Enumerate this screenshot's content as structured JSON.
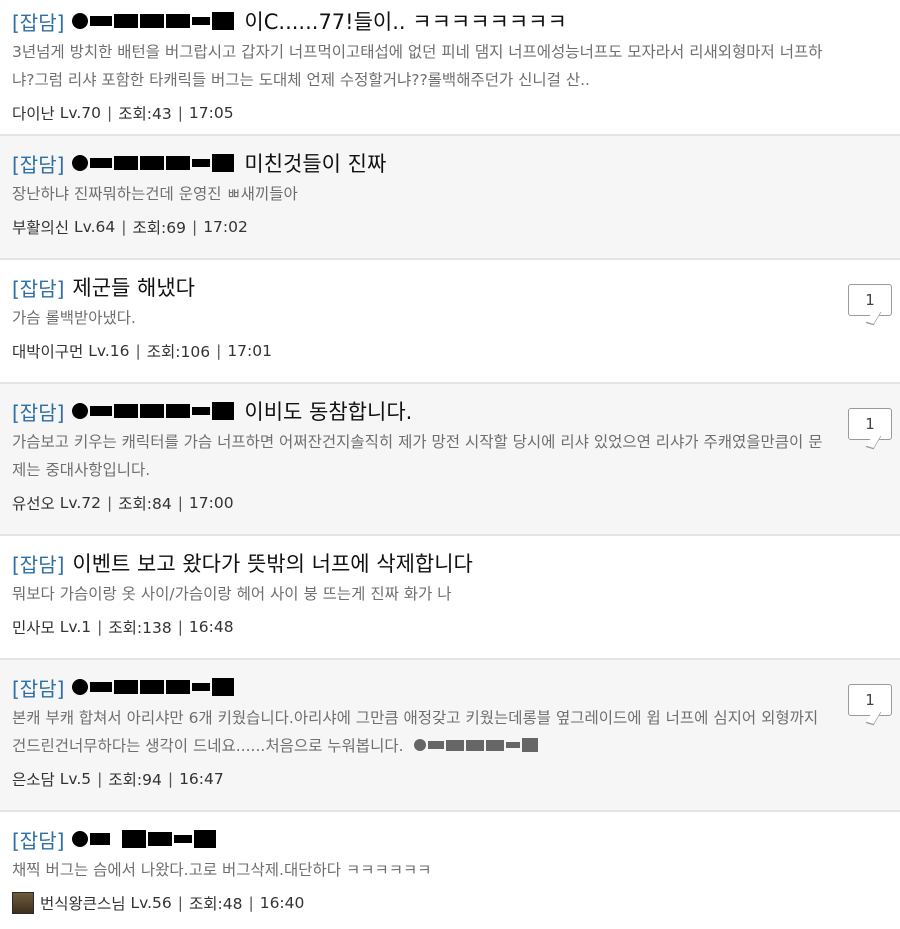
{
  "posts": [
    {
      "category": "[잡담]",
      "title": "이C......77!들이.. ㅋㅋㅋㅋㅋㅋㅋㅋ",
      "masked": true,
      "excerpt": "3년넘게 방치한 배턴을 버그랍시고 갑자기 너프먹이고태섭에 없던 피네 댐지 너프에성능너프도 모자라서 리새외형마저 너프하냐?그럼 리샤 포함한 타캐릭들 버그는 도대체 언제 수정할거냐??롤백해주던가 신니걸 산..",
      "author": "다이난",
      "level": "Lv.70",
      "views": "조회:43",
      "time": "17:05",
      "comments": null
    },
    {
      "category": "[잡담]",
      "title": "미친것들이 진짜",
      "masked": true,
      "excerpt": "장난하냐 진짜뭐하는건데 운영진 ㅃ새끼들아",
      "author": "부활의신",
      "level": "Lv.64",
      "views": "조회:69",
      "time": "17:02",
      "comments": null
    },
    {
      "category": "[잡담]",
      "title": "제군들 해냈다",
      "masked": false,
      "excerpt": "가슴 롤백받아냈다.",
      "author": "대박이구먼",
      "level": "Lv.16",
      "views": "조회:106",
      "time": "17:01",
      "comments": "1"
    },
    {
      "category": "[잡담]",
      "title": "이비도 동참합니다.",
      "masked": true,
      "excerpt": "가슴보고 키우는 캐릭터를 가슴 너프하면 어쩌잔건지솔직히 제가 망전 시작할 당시에 리샤 있었으연 리샤가 주캐였을만큼이 문제는 중대사항입니다.",
      "author": "유선오",
      "level": "Lv.72",
      "views": "조회:84",
      "time": "17:00",
      "comments": "1"
    },
    {
      "category": "[잡담]",
      "title": "이벤트 보고 왔다가 뜻밖의 너프에 삭제합니다",
      "masked": false,
      "excerpt": "뭐보다 가슴이랑 옷 사이/가슴이랑 헤어 사이 붕 뜨는게 진짜 화가 나",
      "author": "민사모",
      "level": "Lv.1",
      "views": "조회:138",
      "time": "16:48",
      "comments": null
    },
    {
      "category": "[잡담]",
      "title": "",
      "masked": true,
      "excerpt": "본캐 부캐 합쳐서 아리샤만 6개 키웠습니다.아리샤에 그만큼 애정갖고 키웠는데롱블 옆그레이드에 윕 너프에 심지어 외형까지 건드린건너무하다는 생각이 드네요......처음으로 누워봅니다.",
      "author": "은소담",
      "level": "Lv.5",
      "views": "조회:94",
      "time": "16:47",
      "comments": "1"
    },
    {
      "category": "[잡담]",
      "title": "",
      "masked": true,
      "excerpt": "채찍 버그는 슴에서 나왔다.고로 버그삭제.대단하다 ㅋㅋㅋㅋㅋㅋ",
      "author": "번식왕큰스님",
      "level": "Lv.56",
      "views": "조회:48",
      "time": "16:40",
      "comments": null
    }
  ],
  "icons": {
    "comment_badge": "speech-bubble-icon",
    "avatar": "user-avatar-image"
  },
  "colors": {
    "category": "#2d6fa6",
    "alt_row_bg": "#f6f6f6",
    "divider": "#e4e4e4"
  }
}
